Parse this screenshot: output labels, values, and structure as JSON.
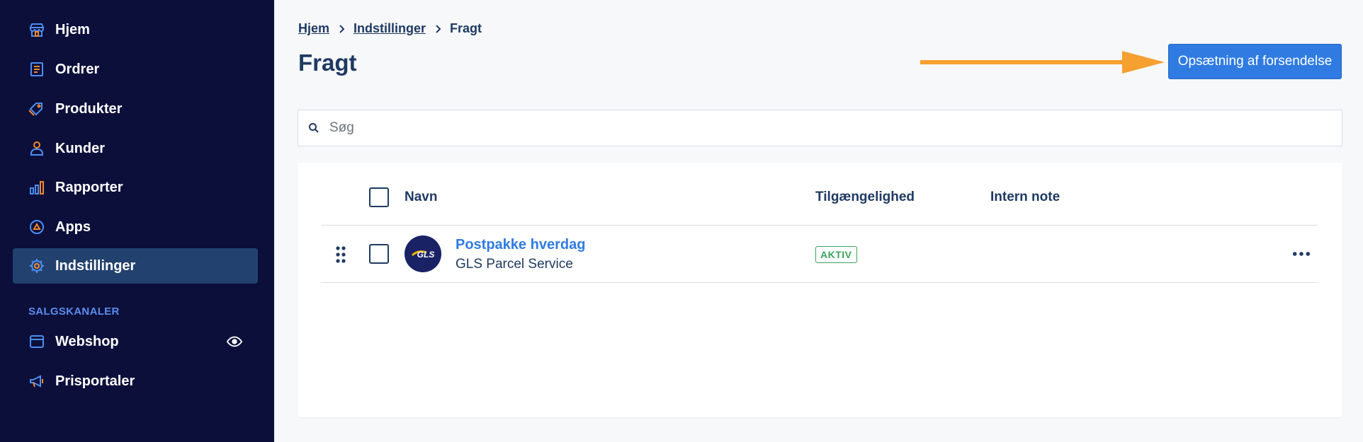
{
  "sidebar": {
    "items": [
      {
        "label": "Hjem",
        "icon": "store-icon"
      },
      {
        "label": "Ordrer",
        "icon": "orders-icon"
      },
      {
        "label": "Produkter",
        "icon": "tag-icon"
      },
      {
        "label": "Kunder",
        "icon": "person-icon"
      },
      {
        "label": "Rapporter",
        "icon": "bar-chart-icon"
      },
      {
        "label": "Apps",
        "icon": "apps-icon"
      },
      {
        "label": "Indstillinger",
        "icon": "gear-icon"
      }
    ],
    "section_title": "SALGSKANALER",
    "channels": [
      {
        "label": "Webshop",
        "icon": "browser-icon"
      },
      {
        "label": "Prisportaler",
        "icon": "megaphone-icon"
      }
    ]
  },
  "breadcrumb": {
    "items": [
      "Hjem",
      "Indstillinger"
    ],
    "current": "Fragt"
  },
  "page": {
    "title": "Fragt",
    "primary_button": "Opsætning af forsendelse"
  },
  "search": {
    "placeholder": "Søg",
    "value": ""
  },
  "table": {
    "columns": [
      "Navn",
      "Tilgængelighed",
      "Intern note"
    ],
    "rows": [
      {
        "name": "Postpakke hverdag",
        "carrier": "GLS Parcel Service",
        "logo_text": "GLS",
        "status": "AKTIV",
        "note": ""
      }
    ]
  },
  "colors": {
    "sidebar_bg": "#0b0f3a",
    "sidebar_active": "#22416e",
    "icon_blue": "#4d8ef0",
    "icon_orange": "#f4892b",
    "primary": "#2f7be2",
    "text_dark": "#1f3a63",
    "status_green": "#3aa35c",
    "arrow_orange": "#f5a02f"
  }
}
